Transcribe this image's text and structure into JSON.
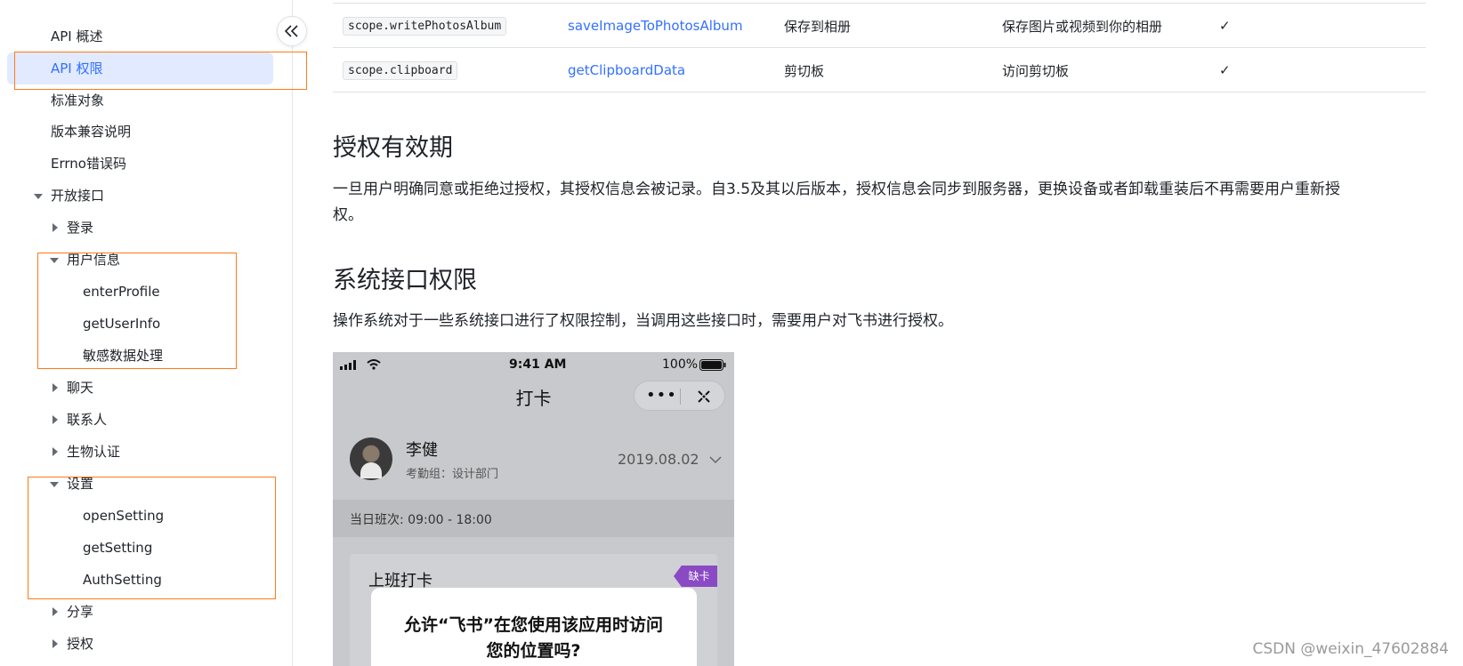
{
  "sidebar": {
    "items": [
      {
        "label": "API 概述"
      },
      {
        "label": "API 权限"
      },
      {
        "label": "标准对象"
      },
      {
        "label": "版本兼容说明"
      },
      {
        "label": "Errno错误码"
      },
      {
        "label": "开放接口"
      },
      {
        "label": "登录"
      },
      {
        "label": "用户信息"
      },
      {
        "label": "enterProfile"
      },
      {
        "label": "getUserInfo"
      },
      {
        "label": "敏感数据处理"
      },
      {
        "label": "聊天"
      },
      {
        "label": "联系人"
      },
      {
        "label": "生物认证"
      },
      {
        "label": "设置"
      },
      {
        "label": "openSetting"
      },
      {
        "label": "getSetting"
      },
      {
        "label": "AuthSetting"
      },
      {
        "label": "分享"
      },
      {
        "label": "授权"
      }
    ]
  },
  "table": {
    "rows": [
      {
        "scope": "scope.writePhotosAlbum",
        "api": "saveImageToPhotosAlbum",
        "name": "保存到相册",
        "desc": "保存图片或视频到你的相册",
        "check": "✓"
      },
      {
        "scope": "scope.clipboard",
        "api": "getClipboardData",
        "name": "剪切板",
        "desc": "访问剪切板",
        "check": "✓"
      }
    ]
  },
  "sections": {
    "validity_title": "授权有效期",
    "validity_text_1": "一旦用户明确同意或拒绝过授权，其授权信息会被记录。自3.5及其以后版本，授权信息会同步到服务器，更换设备或者卸载重装后不再需要用户重新授",
    "validity_text_2": "权。",
    "system_title": "系统接口权限",
    "system_text": "操作系统对于一些系统接口进行了权限控制，当调用这些接口时，需要用户对飞书进行授权。"
  },
  "phone": {
    "time": "9:41 AM",
    "battery": "100%",
    "title": "打卡",
    "user_name": "李健",
    "user_group": "考勤组：设计部门",
    "date": "2019.08.02",
    "shift": "当日班次: 09:00 - 18:00",
    "card_title": "上班打卡",
    "badge": "缺卡",
    "dialog_line1": "允许“飞书”在您使用该应用时访问",
    "dialog_line2": "您的位置吗?"
  },
  "watermark": "CSDN @weixin_47602884",
  "colors": {
    "accent": "#3370ff",
    "highlight_box": "#ff7a1a",
    "active_bg": "#e1eaff"
  }
}
